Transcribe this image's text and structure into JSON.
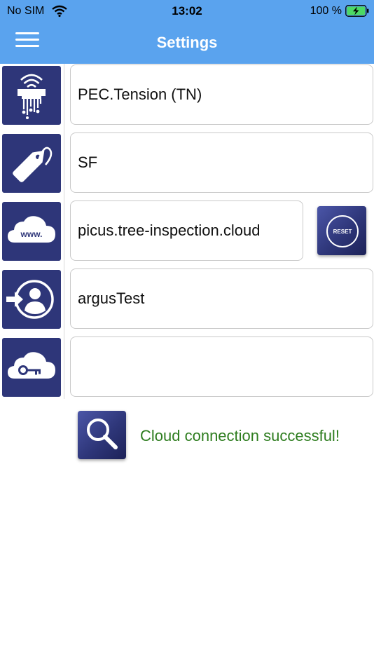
{
  "status_bar": {
    "carrier": "No SIM",
    "time": "13:02",
    "battery_percent": "100 %"
  },
  "header": {
    "title": "Settings",
    "menu_icon": "hamburger-menu-icon"
  },
  "colors": {
    "bar": "#5aa3ee",
    "tile": "#2e3679",
    "success": "#2e7d1f"
  },
  "settings": [
    {
      "icon": "tension-sensor-icon",
      "value": "PEC.Tension (TN)"
    },
    {
      "icon": "tag-icon",
      "value": "SF"
    },
    {
      "icon": "www-cloud-icon",
      "value": "picus.tree-inspection.cloud"
    },
    {
      "icon": "user-login-icon",
      "value": "argusTest"
    },
    {
      "icon": "cloud-key-icon",
      "value": ""
    }
  ],
  "reset_button": {
    "label": "RESET"
  },
  "connection": {
    "test_icon": "magnifier-icon",
    "message": "Cloud connection successful!"
  }
}
